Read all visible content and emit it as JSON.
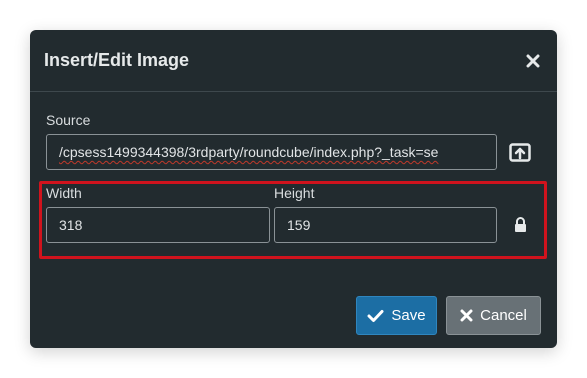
{
  "dialog": {
    "title": "Insert/Edit Image",
    "close_icon": "close-icon"
  },
  "source": {
    "label": "Source",
    "value": "/cpsess1499344398/3rdparty/roundcube/index.php?_task=se",
    "upload_icon": "upload-icon"
  },
  "dimensions": {
    "width_label": "Width",
    "width_value": "318",
    "height_label": "Height",
    "height_value": "159",
    "lock_icon": "lock-icon"
  },
  "buttons": {
    "save_label": "Save",
    "save_icon": "checkmark-icon",
    "cancel_label": "Cancel",
    "cancel_icon": "x-icon"
  },
  "colors": {
    "dialog_bg": "#222b2f",
    "save_button": "#1c6ea4",
    "cancel_button": "#687176",
    "highlight": "#d0131d"
  }
}
